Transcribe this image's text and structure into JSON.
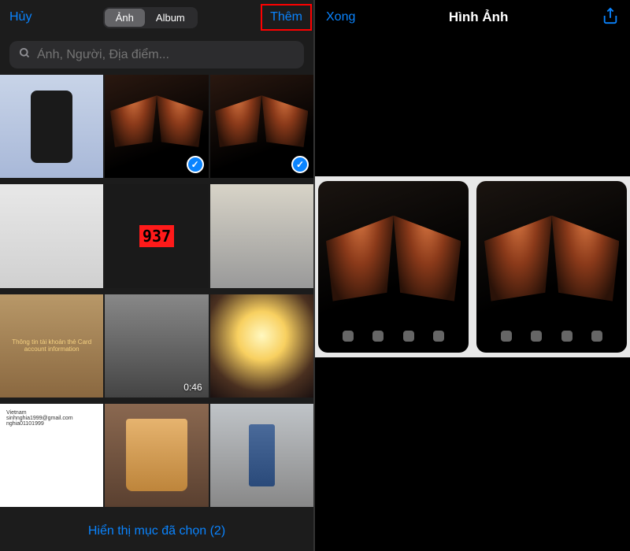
{
  "left": {
    "header": {
      "cancel": "Hủy",
      "tabs": [
        "Ảnh",
        "Album"
      ],
      "activeTab": 0,
      "add": "Thêm"
    },
    "search": {
      "placeholder": "Ảnh, Người, Địa điểm..."
    },
    "grid": {
      "selected": [
        1,
        2
      ],
      "video": {
        "index": 7,
        "duration": "0:46"
      },
      "led": "937",
      "info_text": "Thông tin tài khoản thẻ\nCard account information"
    },
    "bottom": {
      "label": "Hiển thị mục đã chọn (2)"
    }
  },
  "right": {
    "done": "Xong",
    "title": "Hình Ảnh"
  }
}
